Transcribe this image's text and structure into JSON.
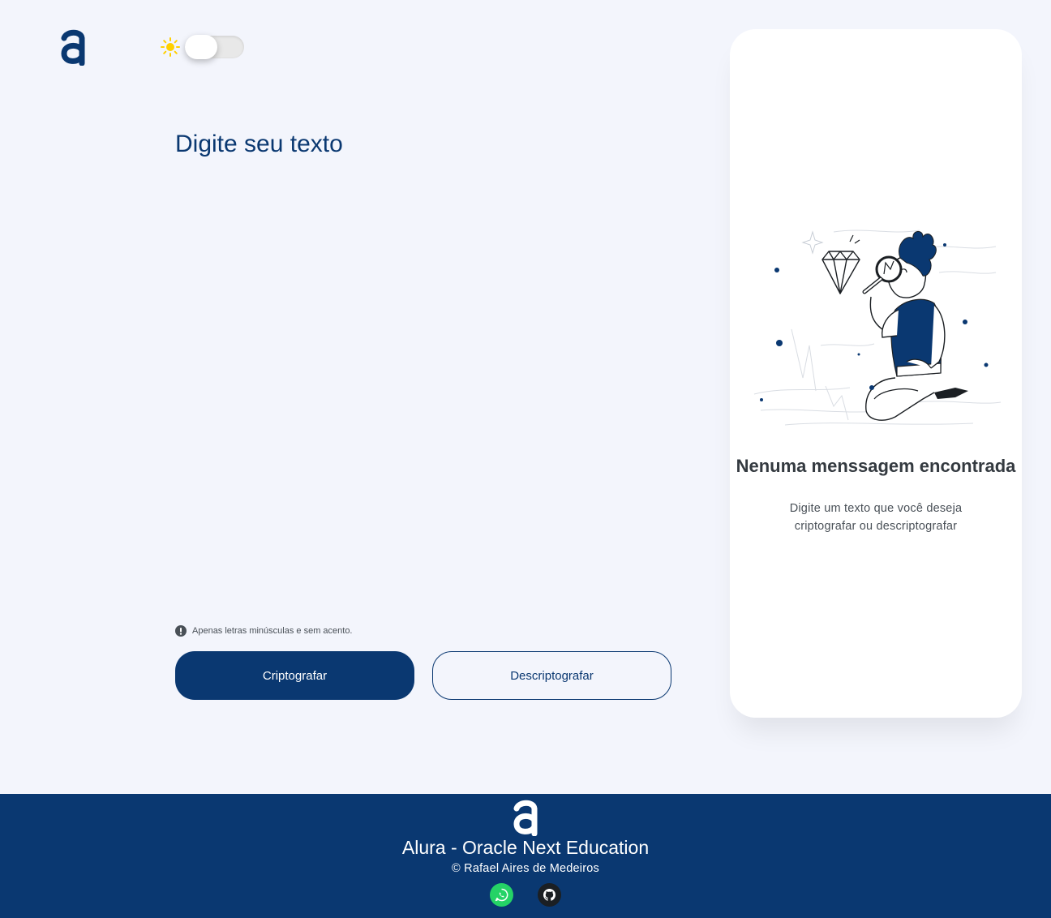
{
  "header": {
    "logo_icon": "alura-logo-icon",
    "theme_toggle": {
      "icon": "sun-icon",
      "state": "light"
    }
  },
  "input": {
    "placeholder": "Digite seu texto",
    "value": ""
  },
  "hint": {
    "icon": "exclamation-circle-icon",
    "text": "Apenas letras minúsculas e sem acento."
  },
  "buttons": {
    "encrypt_label": "Criptografar",
    "decrypt_label": "Descriptografar"
  },
  "output": {
    "illustration_icon": "person-magnifying-glass-illustration",
    "title": "Nenuma menssagem encontrada",
    "text": "Digite um texto que você deseja criptografar ou descriptografar"
  },
  "footer": {
    "logo_icon": "alura-logo-icon",
    "title": "Alura - Oracle Next Education",
    "credit": "© Rafael Aires de Medeiros",
    "social": [
      {
        "icon": "whatsapp-icon",
        "color": "#25d366"
      },
      {
        "icon": "github-icon",
        "color": "#1b1f23"
      }
    ]
  },
  "colors": {
    "background": "#f3f5fc",
    "primary": "#0a3871",
    "card": "#ffffff",
    "heading_text": "#343a40",
    "body_text": "#495057",
    "sun": "#ffd000"
  }
}
